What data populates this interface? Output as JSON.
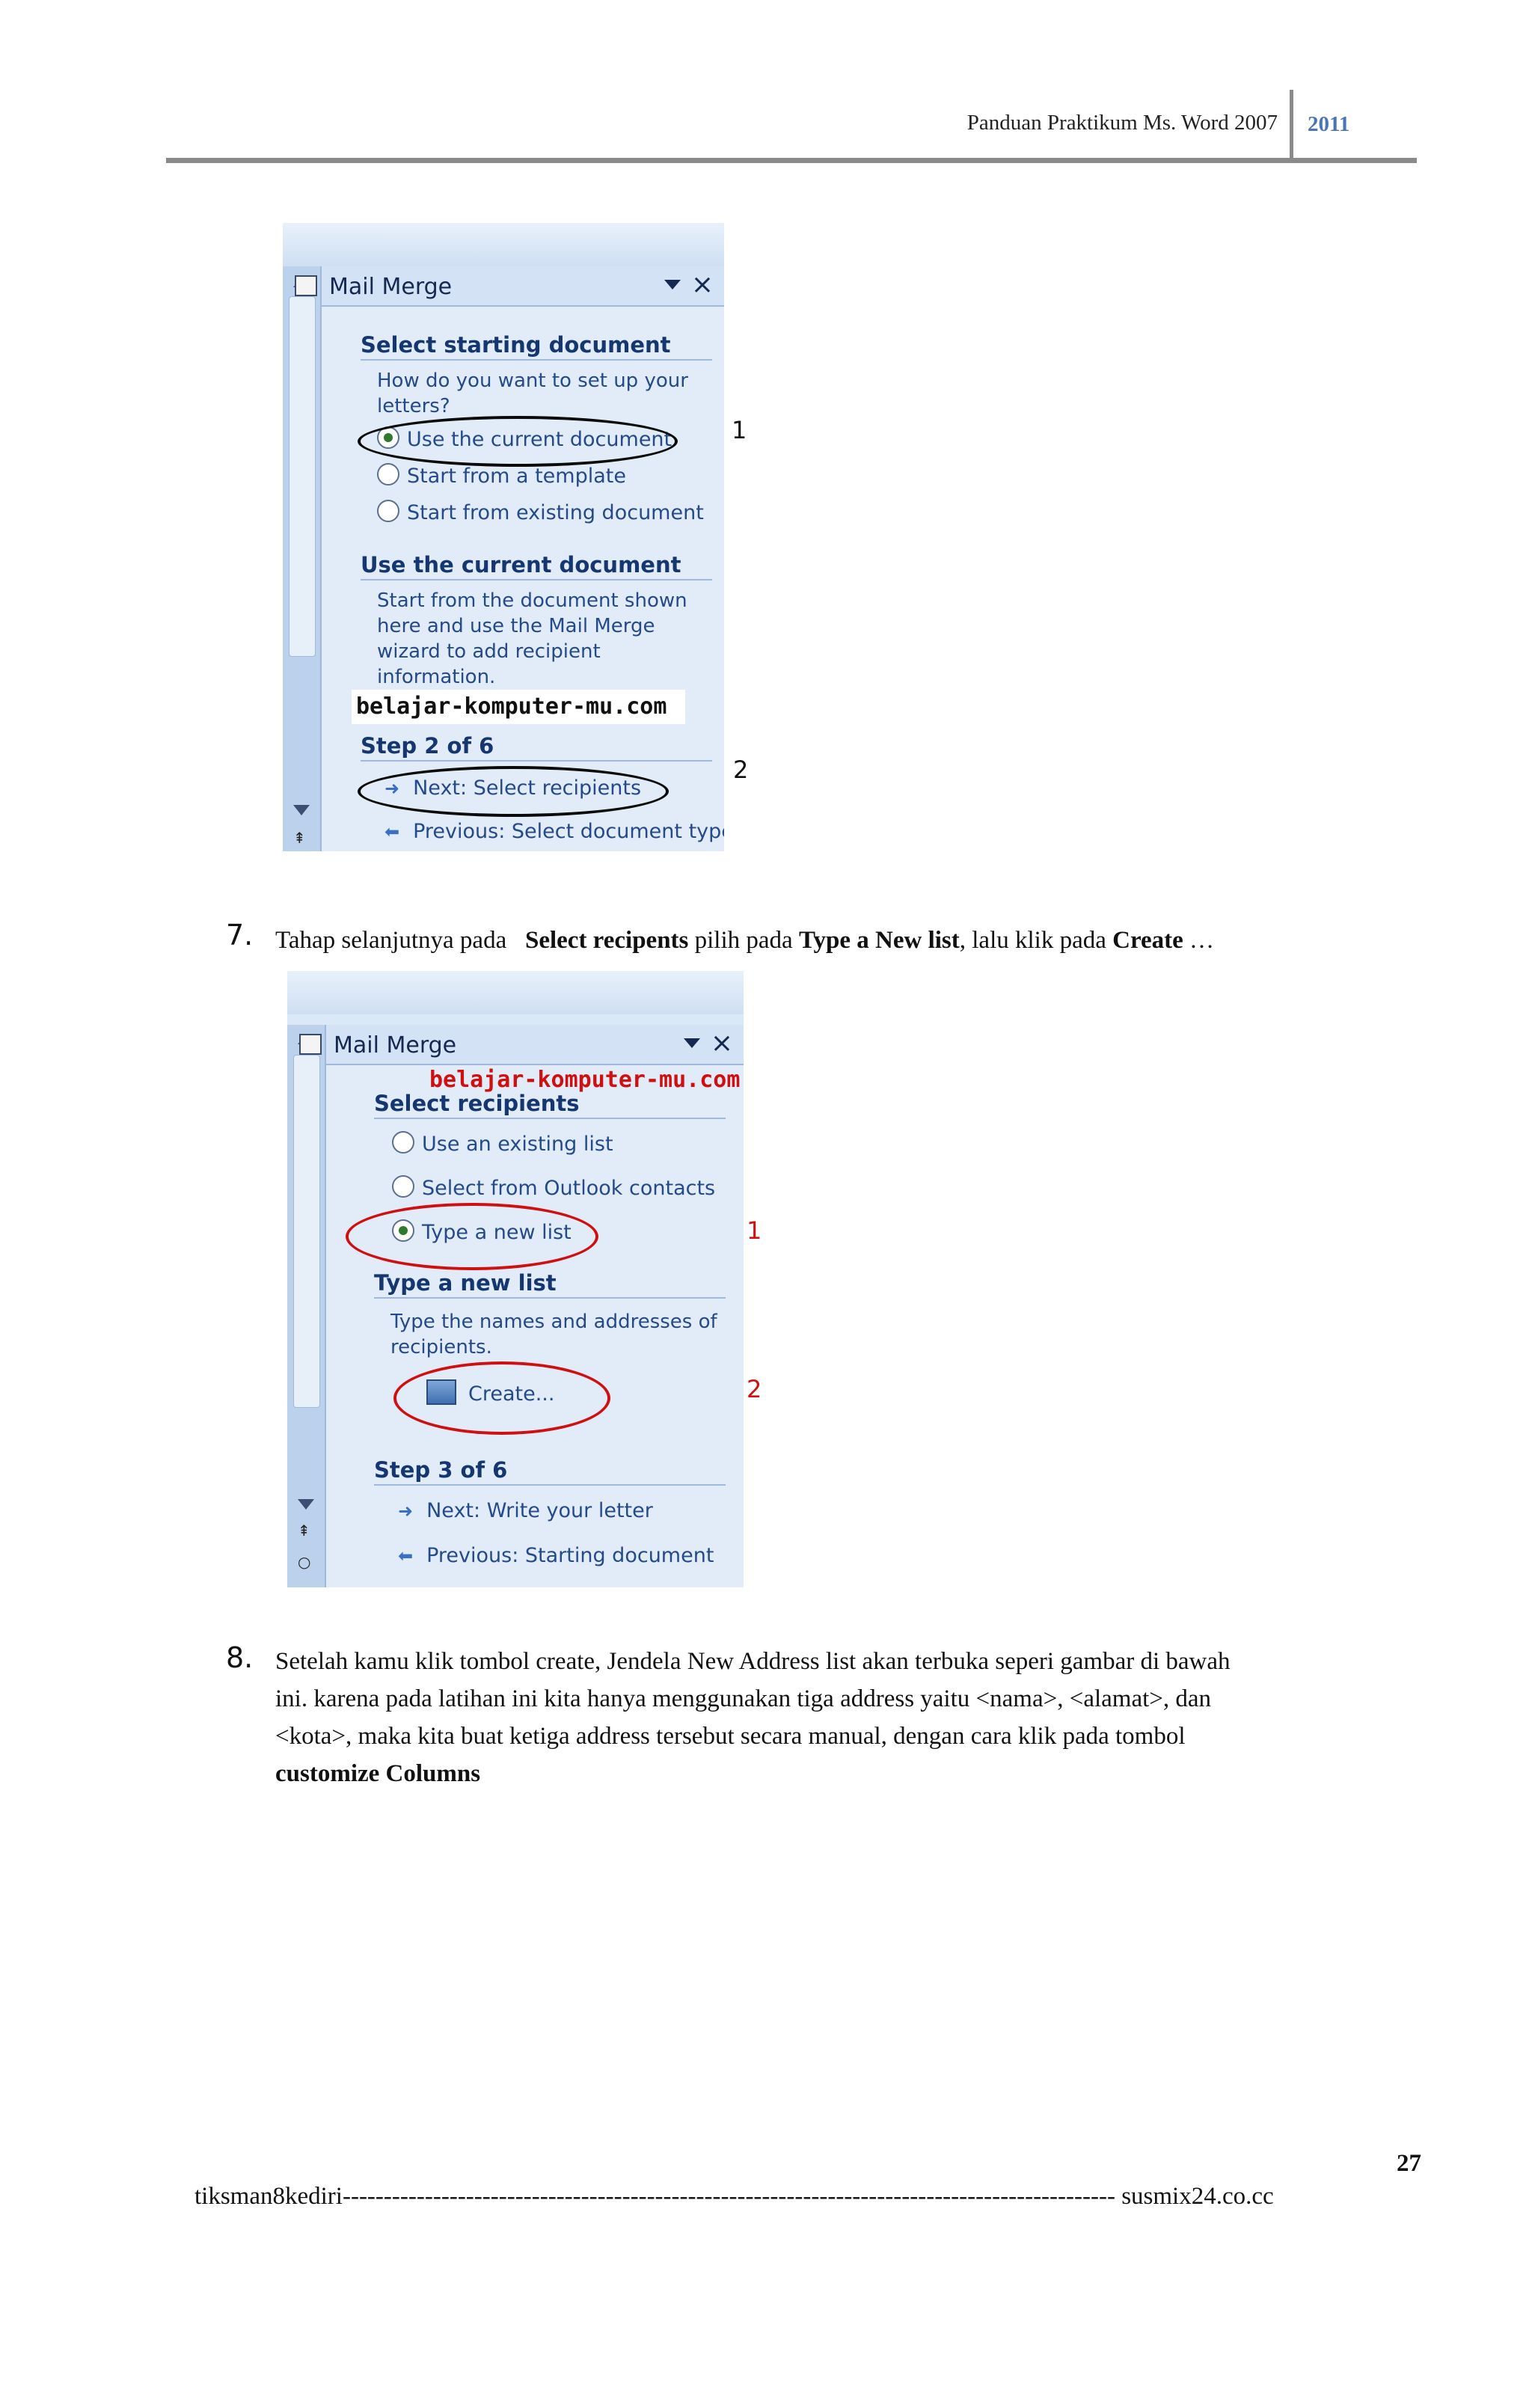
{
  "header": {
    "title": "Panduan Praktikum Ms. Word 2007",
    "year": "2011"
  },
  "pane1": {
    "title": "Mail Merge",
    "section1": "Select starting document",
    "question": "How do you want to set up your letters?",
    "options": [
      "Use the current document",
      "Start from a template",
      "Start from existing document"
    ],
    "section2": "Use the current document",
    "description": "Start from the document shown here and use the Mail Merge wizard to add recipient information.",
    "watermark": "belajar-komputer-mu.com",
    "step": "Step 2 of 6",
    "next": "Next: Select recipients",
    "previous": "Previous: Select document type",
    "marker1": "1",
    "marker2": "2"
  },
  "step7": {
    "number": "7.",
    "text_a": "Tahap selanjutnya pada",
    "bold_a": "Select recipents",
    "text_b": " pilih pada ",
    "bold_b": "Type a New list",
    "text_c": ", lalu klik pada ",
    "bold_c": "Create",
    "text_d": " …"
  },
  "pane2": {
    "title": "Mail Merge",
    "watermark": "belajar-komputer-mu.com",
    "section1": "Select recipients",
    "options": [
      "Use an existing list",
      "Select from Outlook contacts",
      "Type a new list"
    ],
    "section2": "Type a new list",
    "description": "Type the names and addresses of recipients.",
    "create": "Create...",
    "step": "Step 3 of 6",
    "next": "Next: Write your letter",
    "previous": "Previous: Starting document",
    "marker1": "1",
    "marker2": "2"
  },
  "step8": {
    "number": "8.",
    "line1": "Setelah kamu klik tombol create, Jendela  New Address list akan terbuka seperi gambar di bawah",
    "line2": "ini. karena pada latihan ini kita hanya menggunakan tiga address yaitu <nama>, <alamat>, dan",
    "line3": "<kota>, maka kita buat ketiga address tersebut secara manual, dengan cara klik pada tombol",
    "line4_bold": "customize Columns"
  },
  "page_number": "27",
  "footer": "tiksman8kediri---------------------------------------------------------------------------------------------- susmix24.co.cc",
  "colors": {
    "pane_bg": "#dbe8f7",
    "title_blue": "#15366f",
    "red_marker": "#d01010",
    "year_blue": "#4a74b8"
  }
}
